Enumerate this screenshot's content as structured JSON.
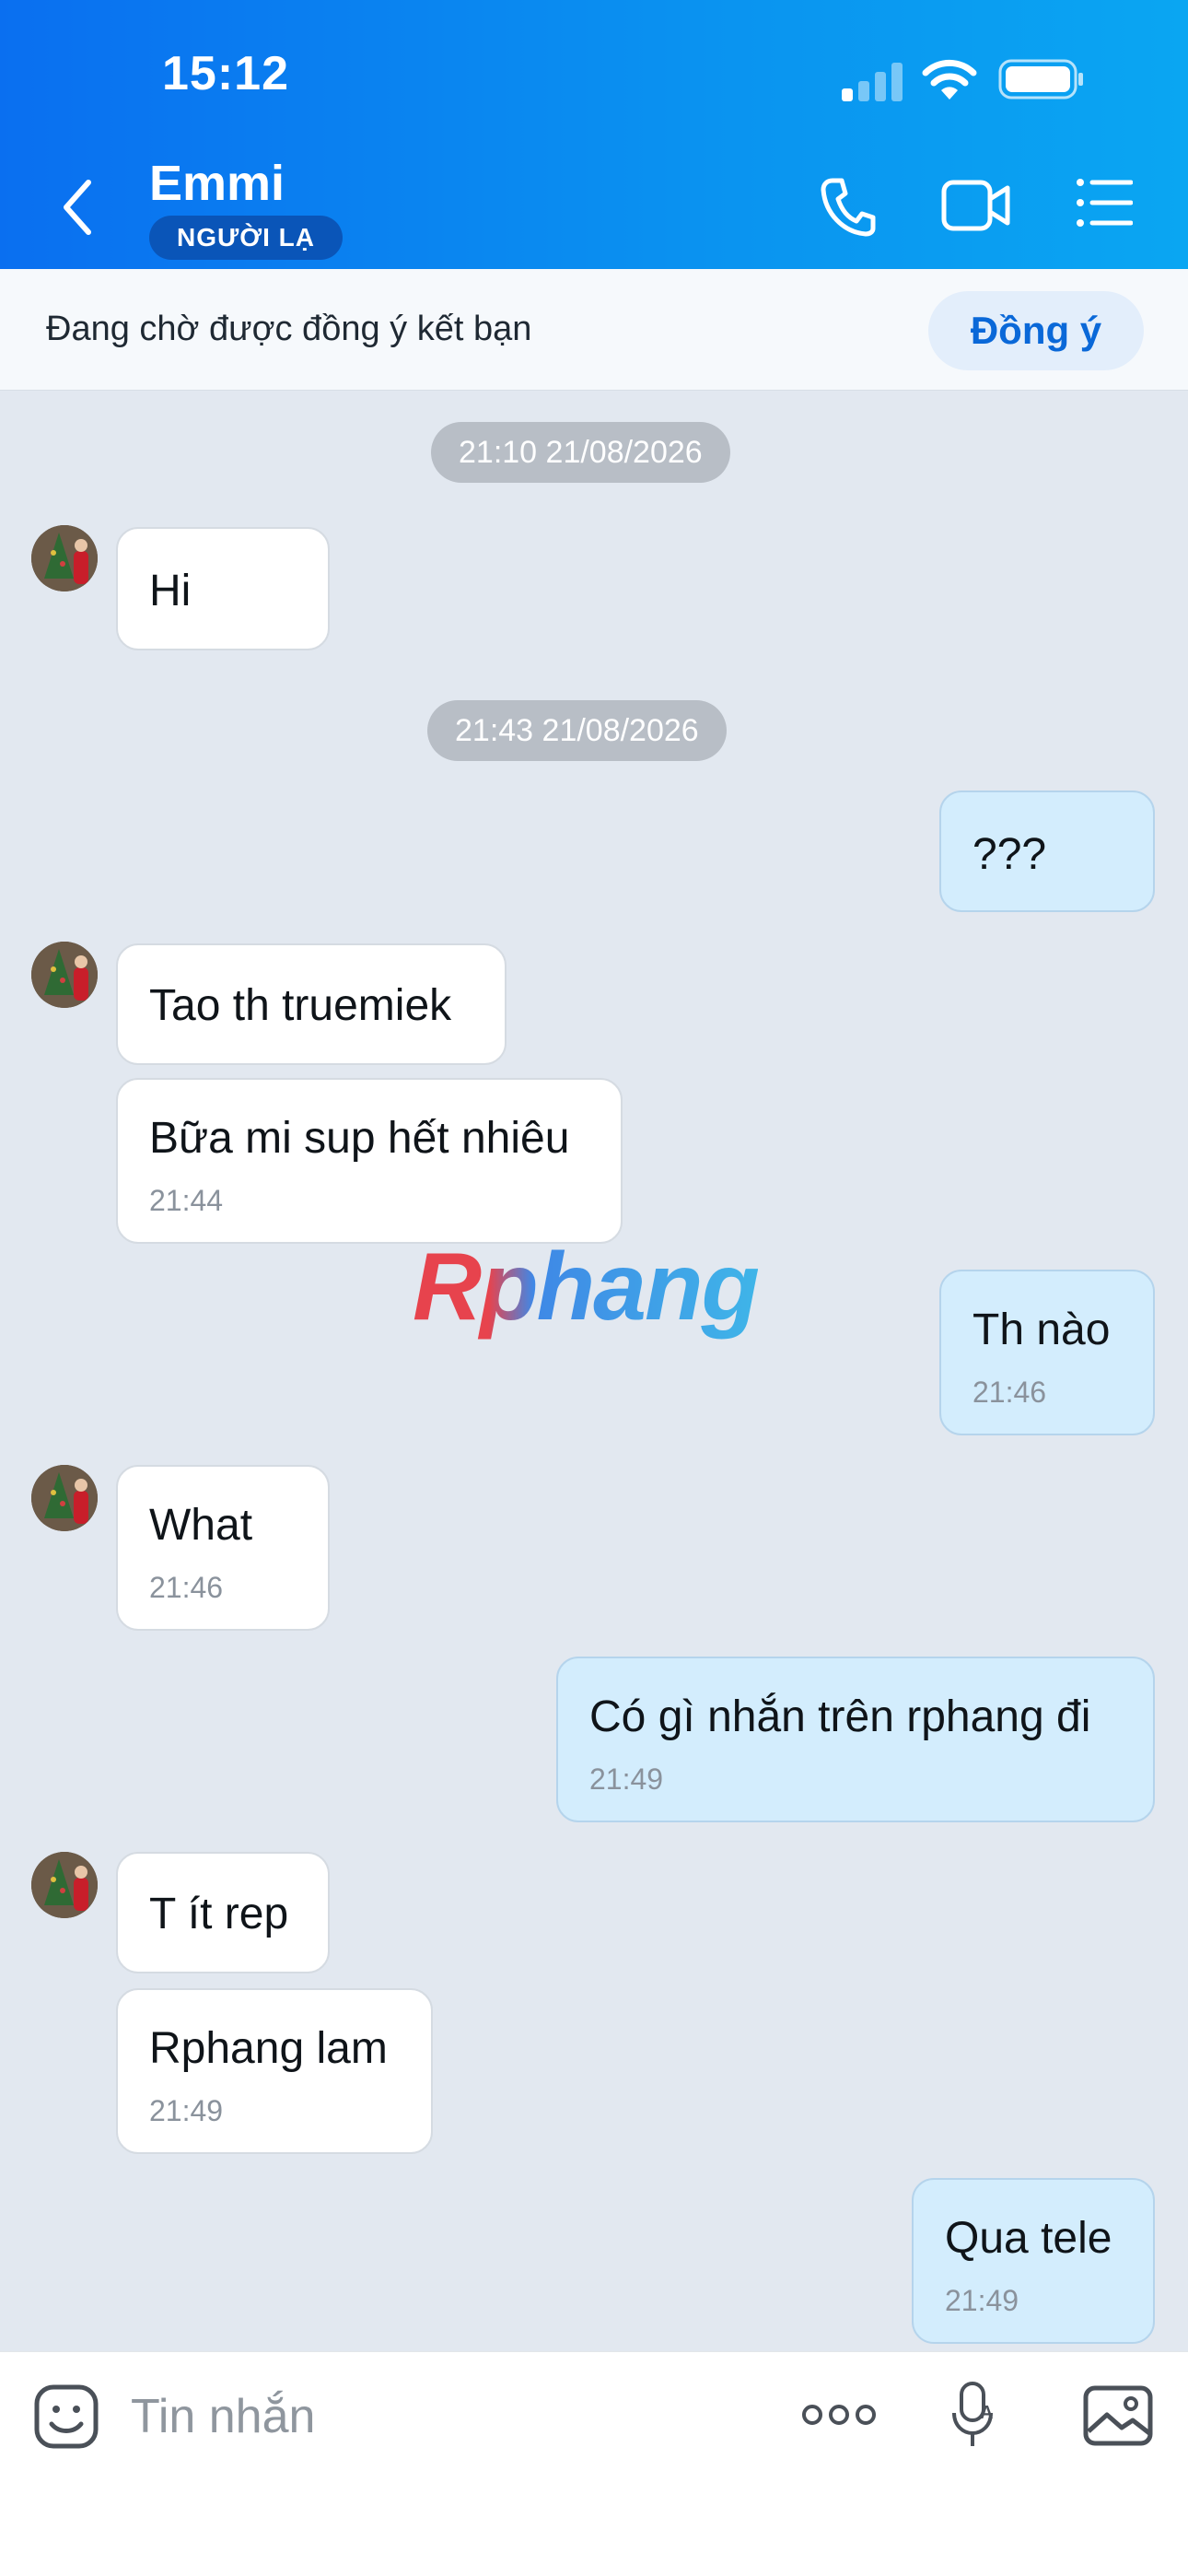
{
  "status_bar": {
    "time": "15:12"
  },
  "header": {
    "contact_name": "Emmi",
    "badge": "NGƯỜI LẠ",
    "icons": [
      "back-icon",
      "phone-icon",
      "video-call-icon",
      "menu-list-icon"
    ]
  },
  "friend_request": {
    "text": "Đang chờ được đồng ý kết bạn",
    "accept_label": "Đồng ý"
  },
  "timestamps": [
    "21:10 21/08/2026",
    "21:43 21/08/2026"
  ],
  "messages": [
    {
      "side": "in",
      "text": "Hi",
      "time": ""
    },
    {
      "side": "out",
      "text": "???",
      "time": ""
    },
    {
      "side": "in",
      "text": "Tao th truemiek",
      "time": ""
    },
    {
      "side": "in",
      "text": "Bữa mi sup hết nhiêu",
      "time": "21:44"
    },
    {
      "side": "out",
      "text": "Th nào",
      "time": "21:46"
    },
    {
      "side": "in",
      "text": "What",
      "time": "21:46"
    },
    {
      "side": "out",
      "text": "Có gì nhắn trên rphang đi",
      "time": "21:49"
    },
    {
      "side": "in",
      "text": "T ít rep",
      "time": ""
    },
    {
      "side": "in",
      "text": "Rphang lam",
      "time": "21:49"
    },
    {
      "side": "out",
      "text": "Qua tele",
      "time": "21:49"
    }
  ],
  "watermark": "Rphang",
  "input": {
    "placeholder": "Tin nhắn",
    "icons": [
      "sticker-icon",
      "more-icon",
      "voice-to-text-icon",
      "image-icon"
    ]
  },
  "colors": {
    "header_gradient_start": "#0a6ff0",
    "header_gradient_end": "#0aa6f2",
    "outgoing_bubble": "#d3edfd",
    "incoming_bubble": "#ffffff",
    "chat_background": "#e2e8f0",
    "accent": "#0a68d8"
  }
}
